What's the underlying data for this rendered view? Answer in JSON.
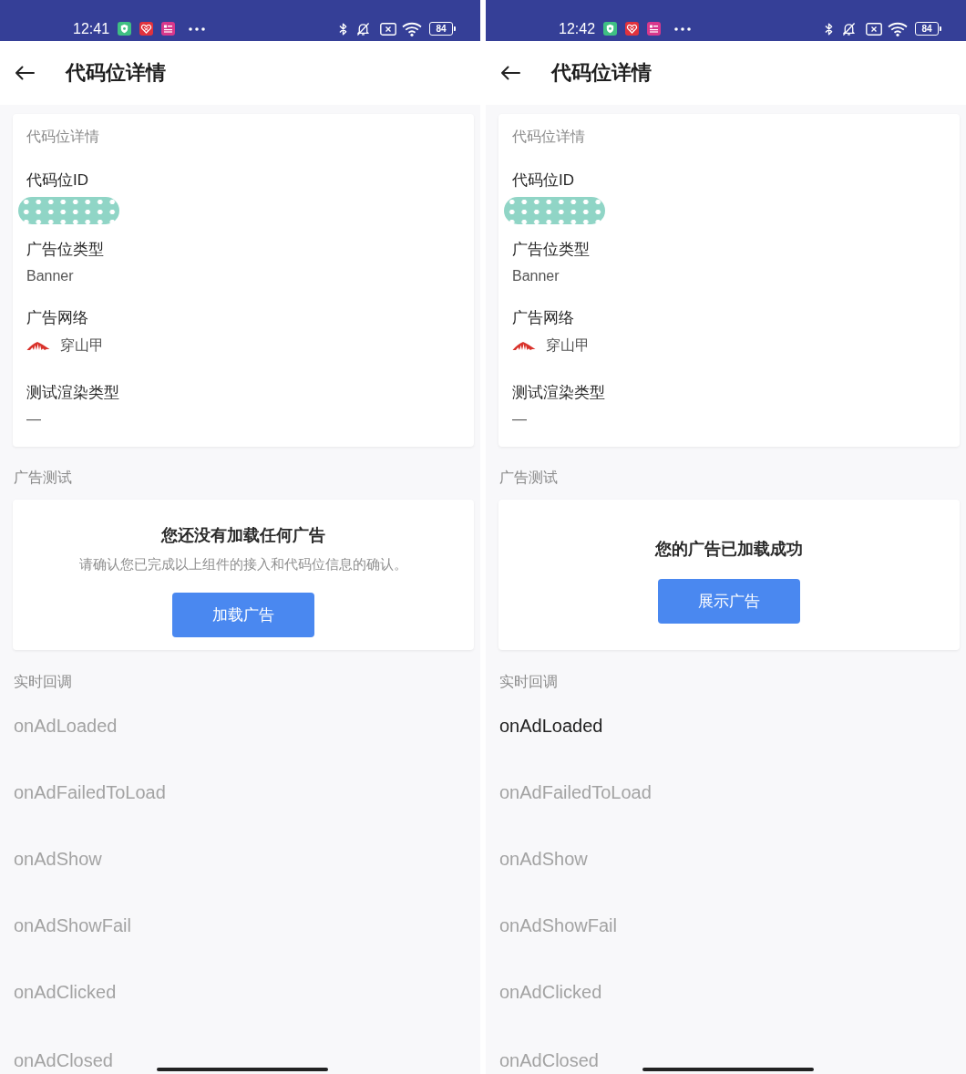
{
  "screens": [
    {
      "status_bar": {
        "time": "12:41",
        "battery": "84"
      },
      "app_bar": {
        "title": "代码位详情"
      },
      "details_card": {
        "heading": "代码位详情",
        "fields": [
          {
            "label": "代码位ID",
            "kind": "redacted"
          },
          {
            "label": "广告位类型",
            "kind": "text",
            "value": "Banner"
          },
          {
            "label": "广告网络",
            "kind": "network",
            "value": "穿山甲"
          },
          {
            "label": "测试渲染类型",
            "kind": "text",
            "value": "—"
          }
        ]
      },
      "ad_test": {
        "section_title": "广告测试",
        "message": "您还没有加载任何广告",
        "hint": "请确认您已完成以上组件的接入和代码位信息的确认。",
        "button": "加载广告"
      },
      "callbacks": {
        "section_title": "实时回调",
        "items": [
          {
            "name": "onAdLoaded",
            "fired": false
          },
          {
            "name": "onAdFailedToLoad",
            "fired": false
          },
          {
            "name": "onAdShow",
            "fired": false
          },
          {
            "name": "onAdShowFail",
            "fired": false
          },
          {
            "name": "onAdClicked",
            "fired": false
          },
          {
            "name": "onAdClosed",
            "fired": false
          }
        ]
      }
    },
    {
      "status_bar": {
        "time": "12:42",
        "battery": "84"
      },
      "app_bar": {
        "title": "代码位详情"
      },
      "details_card": {
        "heading": "代码位详情",
        "fields": [
          {
            "label": "代码位ID",
            "kind": "redacted"
          },
          {
            "label": "广告位类型",
            "kind": "text",
            "value": "Banner"
          },
          {
            "label": "广告网络",
            "kind": "network",
            "value": "穿山甲"
          },
          {
            "label": "测试渲染类型",
            "kind": "text",
            "value": "—"
          }
        ]
      },
      "ad_test": {
        "section_title": "广告测试",
        "message": "您的广告已加载成功",
        "button": "展示广告"
      },
      "callbacks": {
        "section_title": "实时回调",
        "items": [
          {
            "name": "onAdLoaded",
            "fired": true
          },
          {
            "name": "onAdFailedToLoad",
            "fired": false
          },
          {
            "name": "onAdShow",
            "fired": false
          },
          {
            "name": "onAdShowFail",
            "fired": false
          },
          {
            "name": "onAdClicked",
            "fired": false
          },
          {
            "name": "onAdClosed",
            "fired": false
          }
        ]
      }
    }
  ]
}
